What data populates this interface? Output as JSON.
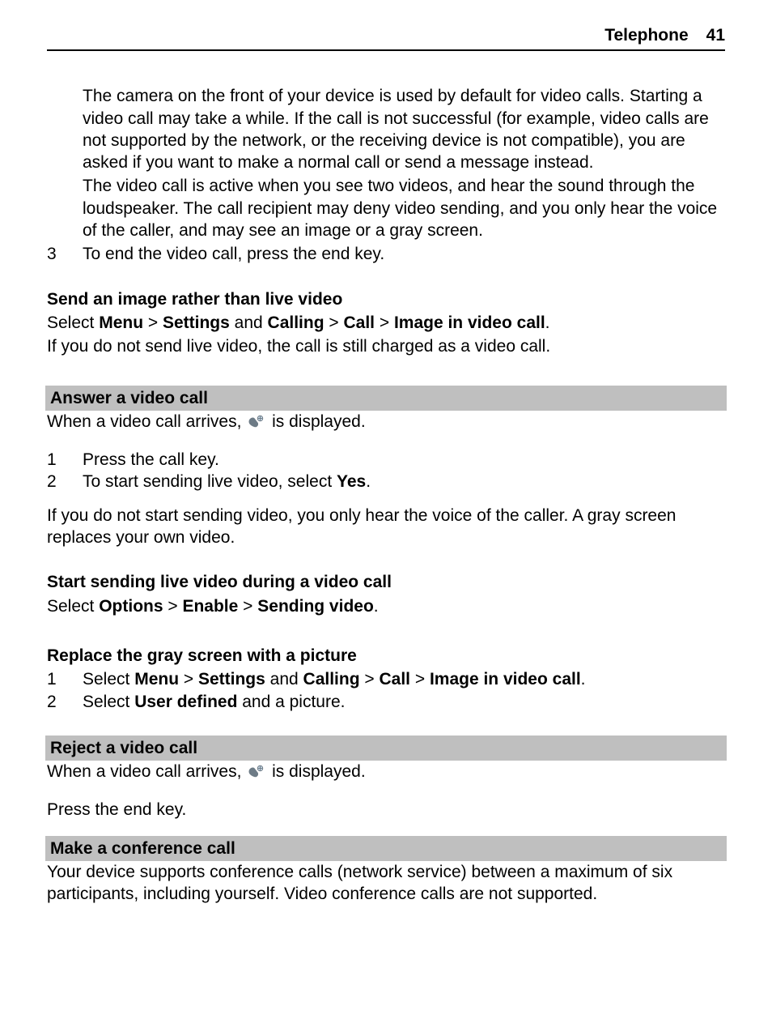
{
  "header": {
    "section": "Telephone",
    "page": "41"
  },
  "block1": {
    "p1": "The camera on the front of your device is used by default for video calls. Starting a video call may take a while. If the call is not successful (for example, video calls are not supported by the network, or the receiving device is not compatible), you are asked if you want to make a normal call or send a message instead.",
    "p2": "The video call is active when you see two videos, and hear the sound through the loudspeaker. The call recipient may deny video sending, and you only hear the voice of the caller, and may see an image or a gray screen."
  },
  "step3": {
    "num": "3",
    "text": "To end the video call, press the end key."
  },
  "sendImage": {
    "title": "Send an image rather than live video",
    "selectWord": "Select ",
    "menu": "Menu",
    "settings": "Settings",
    "and": " and ",
    "calling": "Calling",
    "call": "Call",
    "imgInVideo": "Image in video call",
    "dot": ".",
    "note": "If you do not send live video, the call is still charged as a video call."
  },
  "answer": {
    "title": "Answer a video call",
    "arrivesA": "When a video call arrives, ",
    "arrivesB": " is displayed.",
    "s1n": "1",
    "s1t": "Press the call key.",
    "s2n": "2",
    "s2a": "To start sending live video, select ",
    "s2yes": "Yes",
    "s2b": ".",
    "noStart": "If you do not start sending video, you only hear the voice of the caller. A gray screen replaces your own video."
  },
  "startSending": {
    "title": "Start sending live video during a video call",
    "selectWord": "Select ",
    "options": "Options",
    "enable": "Enable",
    "sendingVideo": "Sending video",
    "dot": "."
  },
  "replaceGray": {
    "title": "Replace the gray screen with a picture",
    "s1n": "1",
    "s1select": "Select ",
    "menu": "Menu",
    "settings": "Settings",
    "and": " and ",
    "calling": "Calling",
    "call": "Call",
    "imgInVideo": "Image in video call",
    "dot": ".",
    "s2n": "2",
    "s2select": "Select ",
    "userDefined": "User defined",
    "s2rest": " and a picture."
  },
  "reject": {
    "title": "Reject a video call",
    "arrivesA": "When a video call arrives, ",
    "arrivesB": " is displayed.",
    "pressEnd": "Press the end key."
  },
  "conference": {
    "title": "Make a conference call",
    "body": "Your device supports conference calls (network service) between a maximum of six participants, including yourself. Video conference calls are not supported."
  }
}
